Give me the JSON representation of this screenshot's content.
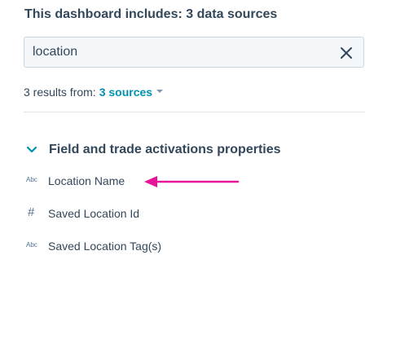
{
  "header": {
    "title": "This dashboard includes: 3 data sources"
  },
  "search": {
    "value": "location",
    "clear_icon": "close-icon"
  },
  "results": {
    "prefix": "3 results from:",
    "sources_link": "3 sources",
    "dropdown_icon": "caret-down-icon"
  },
  "group": {
    "title": "Field and trade activations properties",
    "expanded": true,
    "items": [
      {
        "type": "text",
        "type_icon": "Abc",
        "label": "Location Name"
      },
      {
        "type": "number",
        "type_icon": "#",
        "label": "Saved Location Id"
      },
      {
        "type": "text",
        "type_icon": "Abc",
        "label": "Saved Location Tag(s)"
      }
    ]
  },
  "annotation": {
    "arrow_color": "#e8139a",
    "points_to": "Location Name"
  },
  "colors": {
    "text": "#33475b",
    "link": "#0091ae",
    "border": "#cbd6e2",
    "input_bg": "#f5f8fa"
  }
}
